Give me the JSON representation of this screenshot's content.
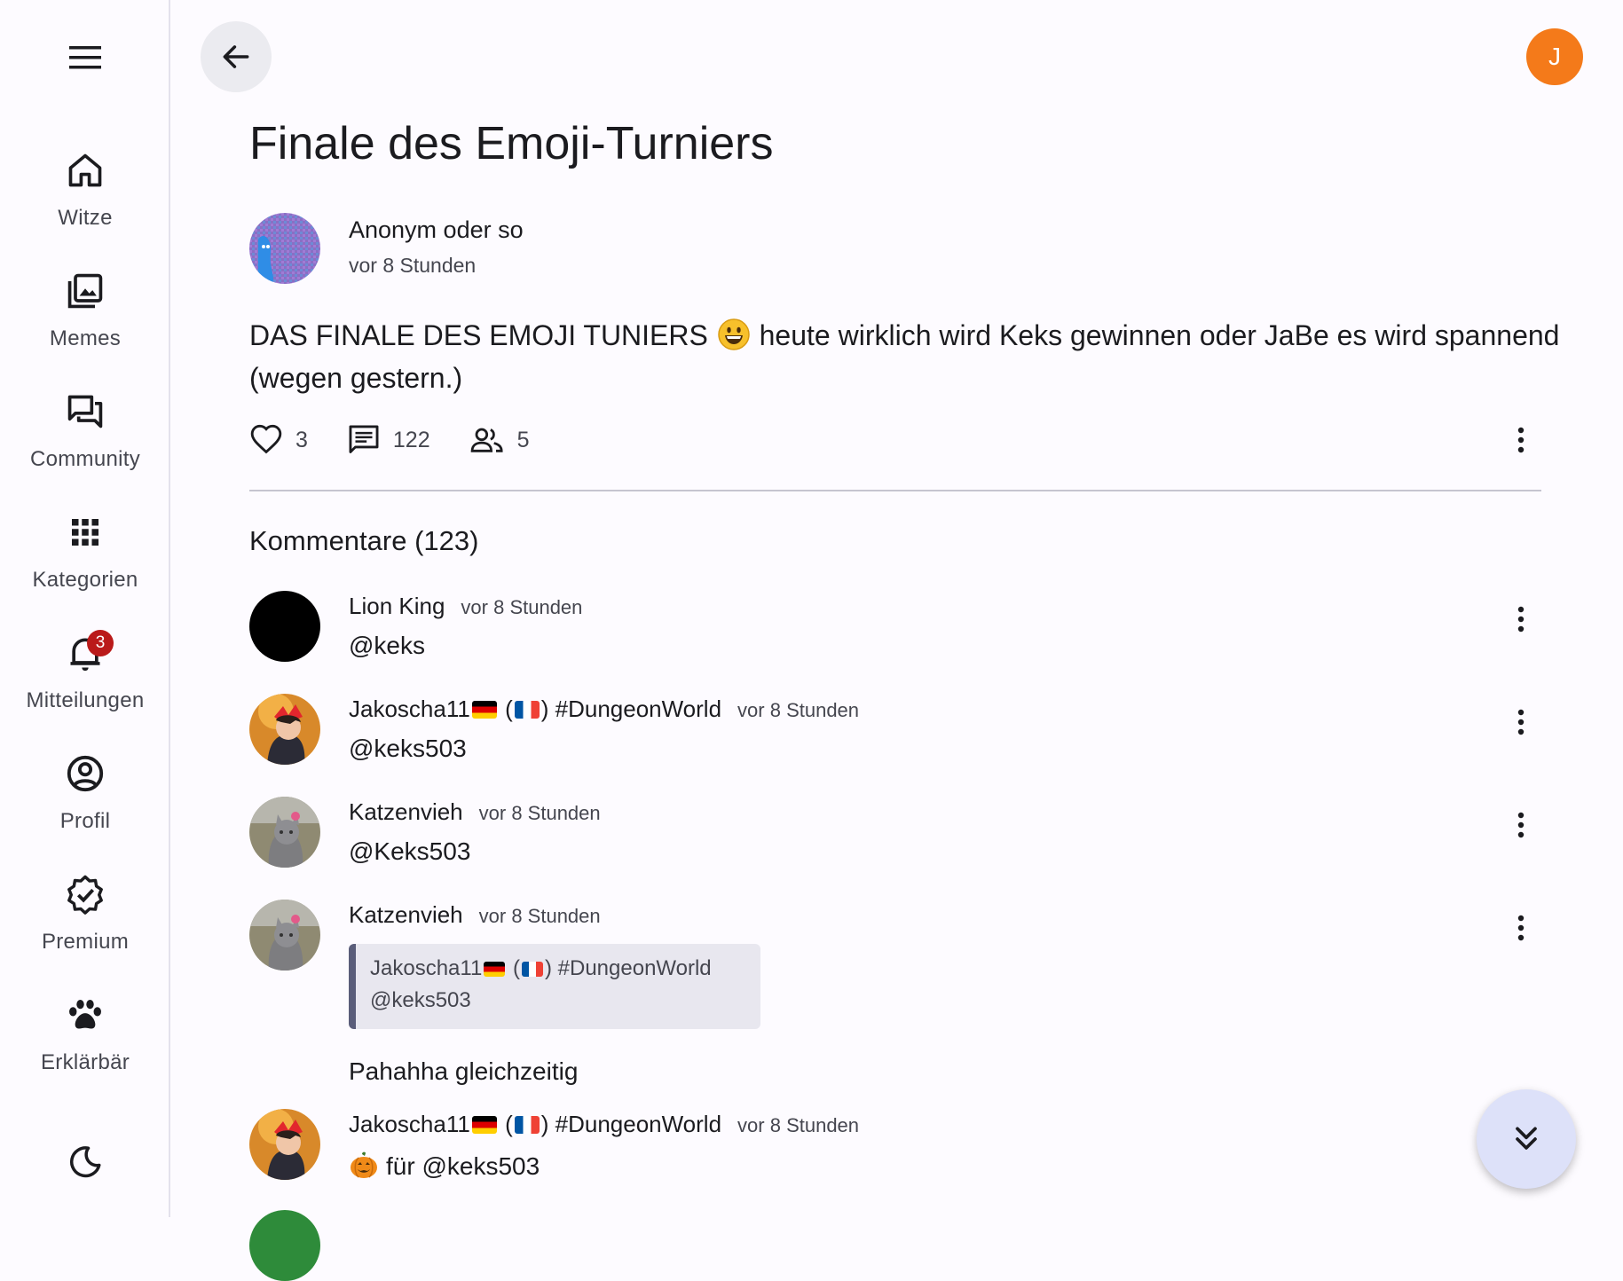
{
  "sidebar": {
    "items": [
      {
        "label": "Witze",
        "icon": "home-icon"
      },
      {
        "label": "Memes",
        "icon": "image-gallery-icon"
      },
      {
        "label": "Community",
        "icon": "forum-icon"
      },
      {
        "label": "Kategorien",
        "icon": "apps-grid-icon"
      },
      {
        "label": "Mitteilungen",
        "icon": "bell-icon",
        "badge": "3"
      },
      {
        "label": "Profil",
        "icon": "account-circle-icon"
      },
      {
        "label": "Premium",
        "icon": "verified-badge-icon"
      },
      {
        "label": "Erklärbär",
        "icon": "paw-icon"
      }
    ]
  },
  "header": {
    "user_initial": "J"
  },
  "post": {
    "title": "Finale des Emoji-Turniers",
    "author": "Anonym oder so",
    "time": "vor 8 Stunden",
    "text_before_emoji": "DAS FINALE DES EMOJI TUNIERS",
    "text_after_emoji": "heute wirklich wird Keks gewinnen oder JaBe es wird spannend (wegen gestern.)",
    "likes": "3",
    "comments": "122",
    "participants": "5"
  },
  "comments_section": {
    "title": "Kommentare (123)",
    "items": [
      {
        "author": "Lion King",
        "time": "vor 8 Stunden",
        "text": "@keks"
      },
      {
        "author_prefix": "Jakoscha11",
        "author_mid": " (",
        "author_suffix": ") #DungeonWorld",
        "time": "vor 8 Stunden",
        "text": "@keks503"
      },
      {
        "author": "Katzenvieh",
        "time": "vor 8 Stunden",
        "text": "@Keks503"
      },
      {
        "author": "Katzenvieh",
        "time": "vor 8 Stunden",
        "quote": {
          "author_prefix": "Jakoscha11",
          "author_mid": " (",
          "author_suffix": ") #DungeonWorld",
          "text": "@keks503"
        },
        "text": "Pahahha gleichzeitig"
      },
      {
        "author_prefix": "Jakoscha11",
        "author_mid": " (",
        "author_suffix": ") #DungeonWorld",
        "time": "vor 8 Stunden",
        "text": "für @keks503"
      }
    ]
  },
  "colors": {
    "accent": "#f47a1a",
    "badge": "#ba1a1a",
    "fab": "#dde1f9"
  }
}
